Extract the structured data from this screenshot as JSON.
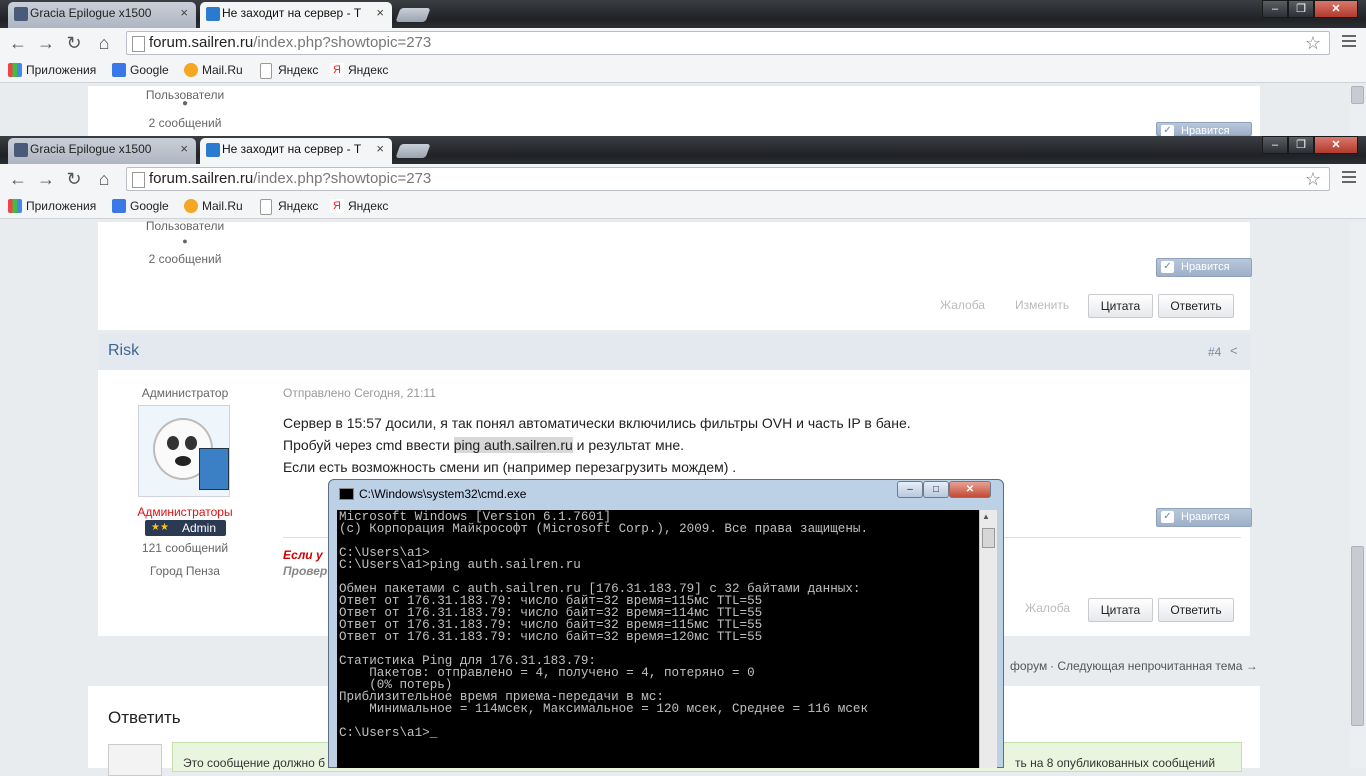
{
  "browser": {
    "tabs": [
      {
        "title": "Gracia Epilogue x1500"
      },
      {
        "title": "Не заходит на сервер - Т"
      }
    ],
    "url_host": "forum.sailren.ru",
    "url_path": "/index.php?showtopic=273",
    "bookmarks": [
      "Приложения",
      "Google",
      "Mail.Ru",
      "Яндекс",
      "Яндекс"
    ]
  },
  "top_post": {
    "group": "Пользователи",
    "posts": "2 сообщений",
    "like_label": "Нравится",
    "actions": {
      "report": "Жалоба",
      "edit": "Изменить",
      "quote": "Цитата",
      "reply": "Ответить"
    }
  },
  "post": {
    "author": "Risk",
    "post_number": "#4",
    "title": "Администратор",
    "group": "Администраторы",
    "badge": "Admin",
    "posts": "121 сообщений",
    "city": "Город Пенза",
    "date": "Отправлено Сегодня, 21:11",
    "line1": "Сервер в 15:57 досили, я так понял автоматически включились фильтры OVH и часть IP в бане.",
    "line2_before": "Пробуй через cmd ввести ",
    "line2_highlight": "ping auth.sailren.ru",
    "line2_after": " и результат мне.",
    "line3": "Если есть возможность смени ип (например перезагрузить мождем) .",
    "signature_line1": "Если у",
    "signature_line2": "Провер",
    "like_label": "Нравится",
    "actions": {
      "report": "Жалоба",
      "quote": "Цитата",
      "reply": "Ответить"
    }
  },
  "nav": {
    "forum": "форум",
    "next": "· Следующая непрочитанная тема →"
  },
  "reply_box": {
    "title": "Ответить",
    "notice_left": "Это сообщение должно б",
    "notice_right": "ть на 8 опубликованных сообщений"
  },
  "cmd": {
    "title": "C:\\Windows\\system32\\cmd.exe",
    "output": "Microsoft Windows [Version 6.1.7601]\n(c) Корпорация Майкрософт (Microsoft Corp.), 2009. Все права защищены.\n\nC:\\Users\\a1>\nC:\\Users\\a1>ping auth.sailren.ru\n\nОбмен пакетами с auth.sailren.ru [176.31.183.79] с 32 байтами данных:\nОтвет от 176.31.183.79: число байт=32 время=115мс TTL=55\nОтвет от 176.31.183.79: число байт=32 время=114мс TTL=55\nОтвет от 176.31.183.79: число байт=32 время=115мс TTL=55\nОтвет от 176.31.183.79: число байт=32 время=120мс TTL=55\n\nСтатистика Ping для 176.31.183.79:\n    Пакетов: отправлено = 4, получено = 4, потеряно = 0\n    (0% потерь)\nПриблизительное время приема-передачи в мс:\n    Минимальное = 114мсек, Максимальное = 120 мсек, Среднее = 116 мсек\n\nC:\\Users\\a1>_"
  }
}
